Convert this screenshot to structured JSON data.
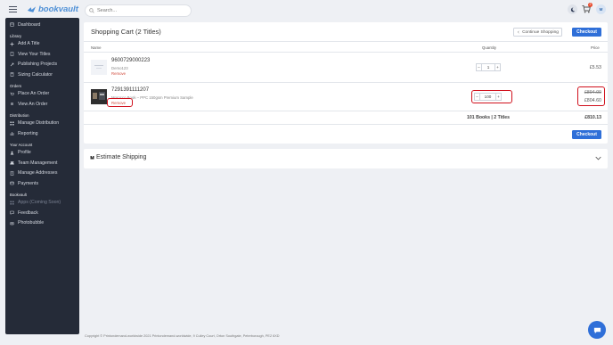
{
  "header": {
    "logo_text": "bookvault",
    "search_placeholder": "Search...",
    "cart_count": "2",
    "user_initial": "M"
  },
  "sidebar": {
    "top_item": "Dashboard",
    "sections": [
      {
        "title": "Library",
        "items": [
          "Add A Title",
          "View Your Titles",
          "Publishing Projects",
          "Sizing Calculator"
        ]
      },
      {
        "title": "Orders",
        "items": [
          "Place An Order",
          "View An Order"
        ]
      },
      {
        "title": "Distribution",
        "items": [
          "Manage Distribution",
          "Reporting"
        ]
      },
      {
        "title": "Your Account",
        "items": [
          "Profile",
          "Team Management",
          "Manage Addresses",
          "Payments"
        ]
      },
      {
        "title": "Bookvault",
        "items": [
          "Apps (Coming Soon)",
          "Feedback",
          "Photobubble"
        ]
      }
    ]
  },
  "cart": {
    "title": "Shopping Cart (2 Titles)",
    "continue_label": "Continue Shopping",
    "checkout_label": "Checkout",
    "col_name": "Name",
    "col_quantity": "Quantity",
    "col_price": "Price",
    "items": [
      {
        "isbn": "9600729000223",
        "subtitle": "Demo123",
        "remove": "Remove",
        "qty": "1",
        "price": "£5.53"
      },
      {
        "isbn": "7291391111207",
        "subtitle": "Morocco Book – PPC 150gsm Premium Sample",
        "remove": "Remove",
        "qty": "100",
        "price_old": "£894.00",
        "price": "£804.60"
      }
    ],
    "totals_label": "101 Books | 2 Titles",
    "total": "£810.13",
    "minus": "−",
    "plus": "+"
  },
  "shipping": {
    "title": "Estimate Shipping"
  },
  "footer": {
    "text": "Copyright © Printondemand-worldwide 2021 Printondemand-worldwide, 9 Culley Court, Orton Southgate, Peterborough, PE2 6XD"
  },
  "colors": {
    "accent": "#2f6fd8",
    "sidebar_bg": "#252b38",
    "remove": "#d0493a",
    "highlight": "#d0101c"
  }
}
